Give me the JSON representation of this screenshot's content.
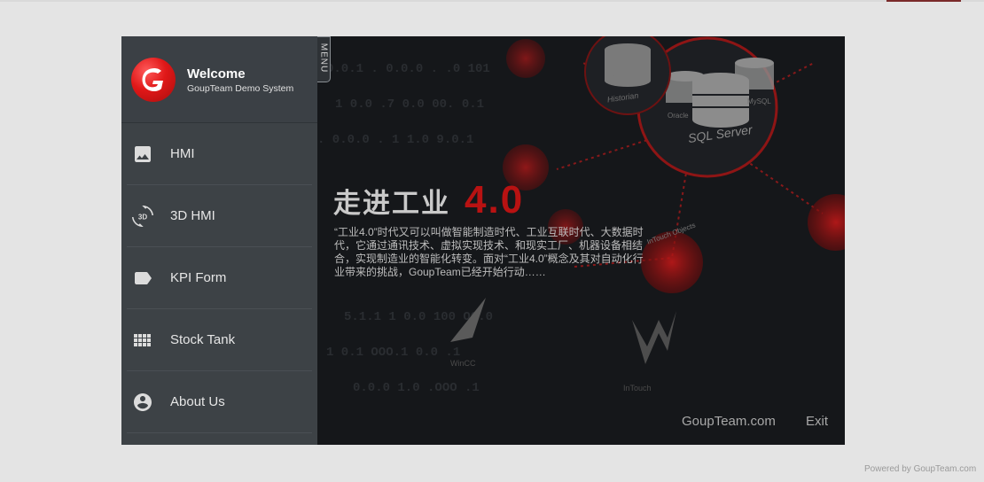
{
  "header": {
    "welcome": "Welcome",
    "subtitle": "GoupTeam Demo System"
  },
  "menu_tab": "MENU",
  "nav": {
    "items": [
      {
        "label": "HMI",
        "icon": "image-icon"
      },
      {
        "label": "3D HMI",
        "icon": "3d-rotation-icon"
      },
      {
        "label": "KPI Form",
        "icon": "label-tag-icon"
      },
      {
        "label": "Stock Tank",
        "icon": "grid-icon"
      },
      {
        "label": "About Us",
        "icon": "account-circle-icon"
      }
    ]
  },
  "hero": {
    "title_cn": "走进工业",
    "title_num": "4.0",
    "description": "“工业4.0”时代又可以叫做智能制造时代、工业互联时代、大数据时代，它通过通讯技术、虚拟实现技术、和现实工厂、机器设备相结合，实现制造业的智能化转变。面对“工业4.0”概念及其对自动化行业带来的挑战，GoupTeam已经开始行动……"
  },
  "background_labels": {
    "sql": "SQL Server",
    "historian": "Historian",
    "oracle": "Oracle",
    "mysql": "MySQL",
    "intouch_objects": "InTouch Objects",
    "wincc": "WinCC",
    "intouch": "InTouch"
  },
  "footer": {
    "link": "GoupTeam.com",
    "exit": "Exit"
  },
  "powered_by": "Powered by GoupTeam.com",
  "colors": {
    "brand_red": "#e01818",
    "sidebar_bg": "#3d4246",
    "content_bg": "#15171a"
  }
}
